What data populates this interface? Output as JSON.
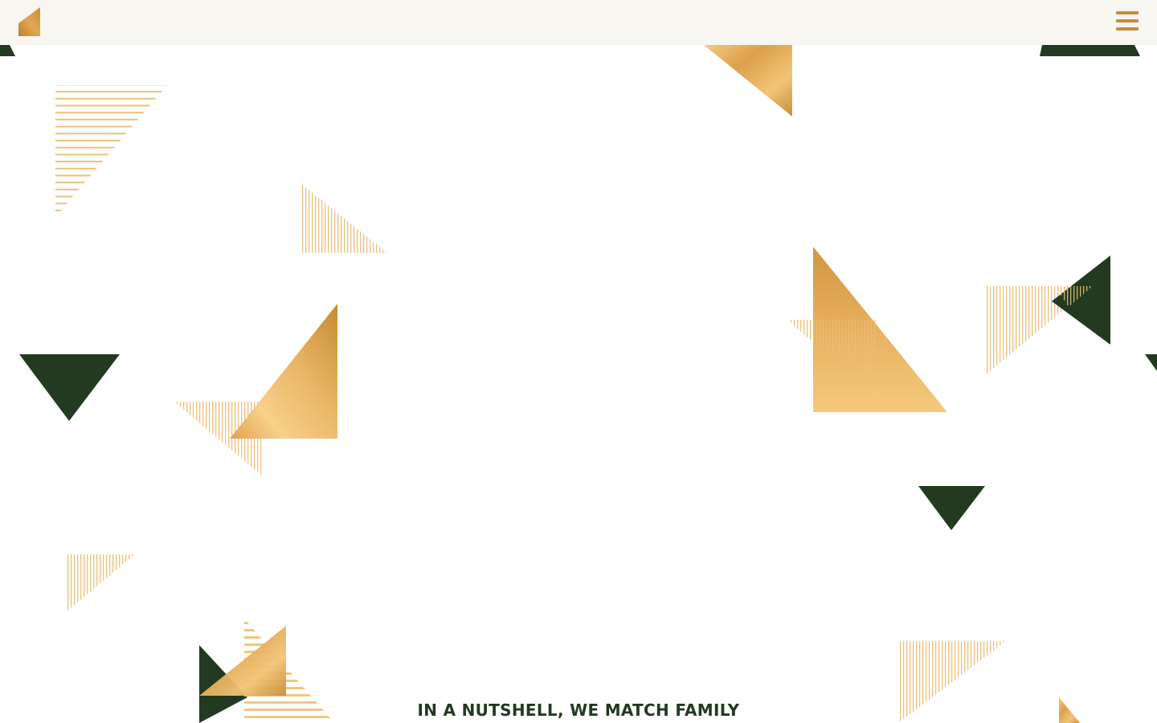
{
  "header": {
    "logo_icon": "gold-triangle-logo-icon",
    "menu_icon": "hamburger-menu-icon"
  },
  "hero": {
    "tagline": "IN A NUTSHELL, WE MATCH FAMILY"
  },
  "colors": {
    "header_bg": "#f8f6f1",
    "page_bg": "#ffffff",
    "forest_green": "#223a20",
    "gold": "#e3aa55",
    "gold_light": "#f6cb80",
    "gold_dark": "#c58a33",
    "stripe_gold": "#eec07a"
  }
}
